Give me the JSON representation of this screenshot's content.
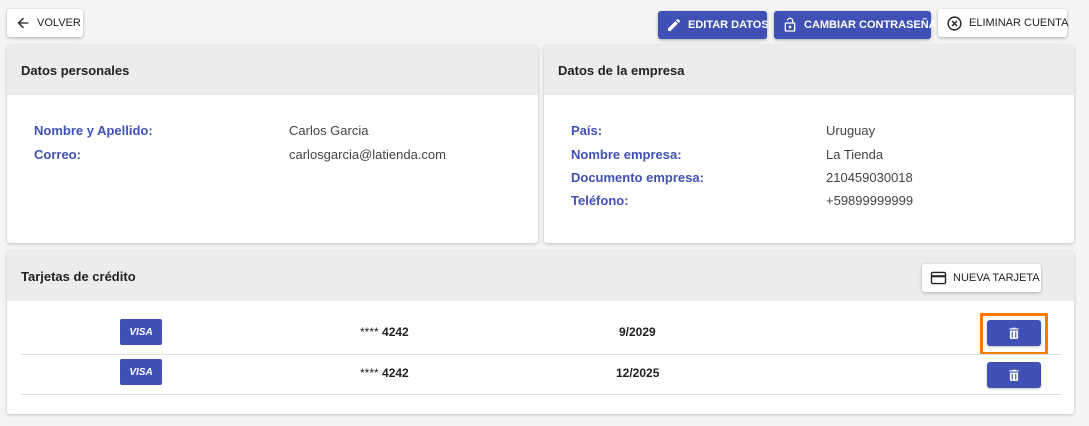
{
  "toolbar": {
    "back_label": "VOLVER",
    "edit_label": "EDITAR DATOS",
    "change_password_label": "CAMBIAR CONTRASEÑA",
    "delete_account_label": "ELIMINAR CUENTA"
  },
  "personal": {
    "title": "Datos personales",
    "fields": [
      {
        "label": "Nombre y Apellido:",
        "value": "Carlos Garcia"
      },
      {
        "label": "Correo:",
        "value": "carlosgarcia@latienda.com"
      }
    ]
  },
  "company": {
    "title": "Datos de la empresa",
    "fields": [
      {
        "label": "País:",
        "value": "Uruguay"
      },
      {
        "label": "Nombre empresa:",
        "value": "La Tienda"
      },
      {
        "label": "Documento empresa:",
        "value": "210459030018"
      },
      {
        "label": "Teléfono:",
        "value": "+59899999999"
      }
    ]
  },
  "cards": {
    "title": "Tarjetas de crédito",
    "new_card_label": "NUEVA TARJETA",
    "items": [
      {
        "brand": "VISA",
        "mask": "****",
        "last4": "4242",
        "expiry": "9/2029"
      },
      {
        "brand": "VISA",
        "mask": "****",
        "last4": "4242",
        "expiry": "12/2025"
      }
    ]
  },
  "colors": {
    "accent": "#3f51b5",
    "highlight": "#f57c00"
  },
  "icons": {
    "back": "arrow-left-icon",
    "edit": "pencil-icon",
    "password": "lock-icon",
    "delete_account": "close-circle-icon",
    "new_card": "credit-card-icon",
    "delete_card": "trash-icon"
  }
}
